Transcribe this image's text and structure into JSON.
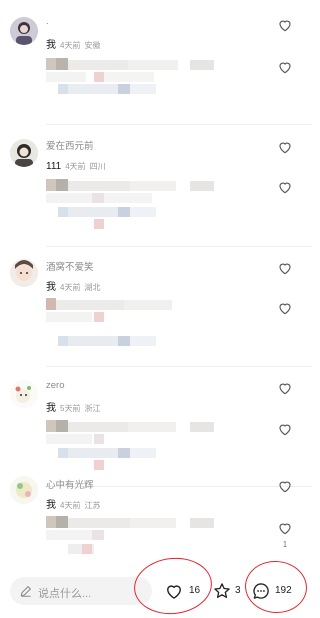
{
  "comments": [
    {
      "user": ".",
      "body": "我",
      "time": "4天前",
      "location": "安徽",
      "like_count": ""
    },
    {
      "user": "爱在西元前",
      "body": "111",
      "time": "4天前",
      "location": "四川",
      "like_count": ""
    },
    {
      "user": "酒窝不爱笑",
      "body": "我",
      "time": "4天前",
      "location": "湖北",
      "like_count": ""
    },
    {
      "user": "zero",
      "body": "我",
      "time": "5天前",
      "location": "浙江",
      "like_count": ""
    },
    {
      "user": "心中有光辉",
      "body": "我",
      "time": "4天前",
      "location": "江苏",
      "like_count": "1"
    }
  ],
  "bottom_bar": {
    "input_placeholder": "说点什么...",
    "likes": "16",
    "favorites": "3",
    "comments": "192"
  },
  "icons": {
    "like": "heart-outline-icon",
    "favorite": "star-outline-icon",
    "comment": "chat-bubble-icon",
    "compose": "pencil-icon"
  },
  "colors": {
    "annotation_red": "#e8232a",
    "muted_text": "#999999",
    "input_bg": "#f3f3f3"
  }
}
